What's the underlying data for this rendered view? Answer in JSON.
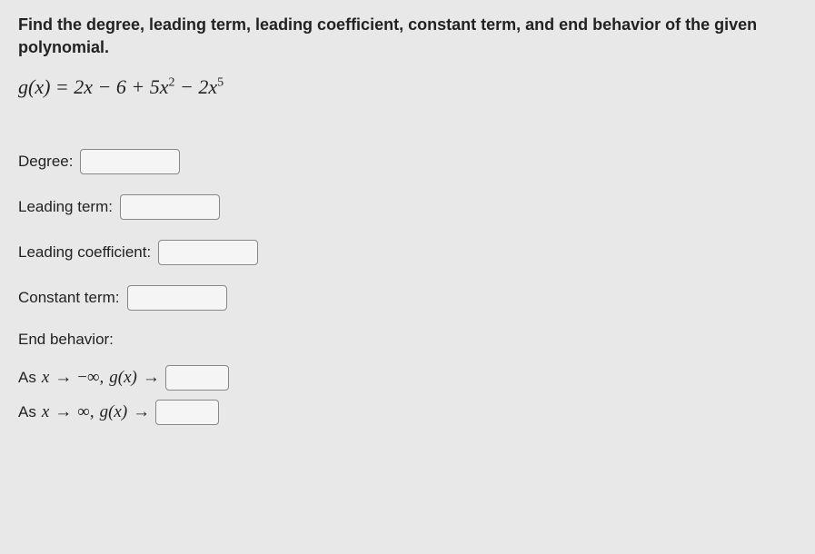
{
  "prompt": "Find the degree, leading term, leading coefficient, constant term, and end behavior of the given polynomial.",
  "formula": {
    "lhs": "g(x)",
    "rhs_parts": [
      "2x",
      " − 6 + 5x",
      " − 2x"
    ],
    "sup1": "2",
    "sup2": "5"
  },
  "fields": {
    "degree": {
      "label": "Degree:",
      "value": ""
    },
    "leading_term": {
      "label": "Leading term:",
      "value": ""
    },
    "leading_coefficient": {
      "label": "Leading coefficient:",
      "value": ""
    },
    "constant_term": {
      "label": "Constant term:",
      "value": ""
    }
  },
  "end_behavior": {
    "header": "End behavior:",
    "row1": {
      "as": "As ",
      "x": "x",
      "arrow1": " → ",
      "neg_inf": "−∞, ",
      "gx": "g(x)",
      "arrow2": " → ",
      "value": ""
    },
    "row2": {
      "as": "As ",
      "x": "x",
      "arrow1": " → ",
      "inf": "∞, ",
      "gx": "g(x)",
      "arrow2": " → ",
      "value": ""
    }
  }
}
